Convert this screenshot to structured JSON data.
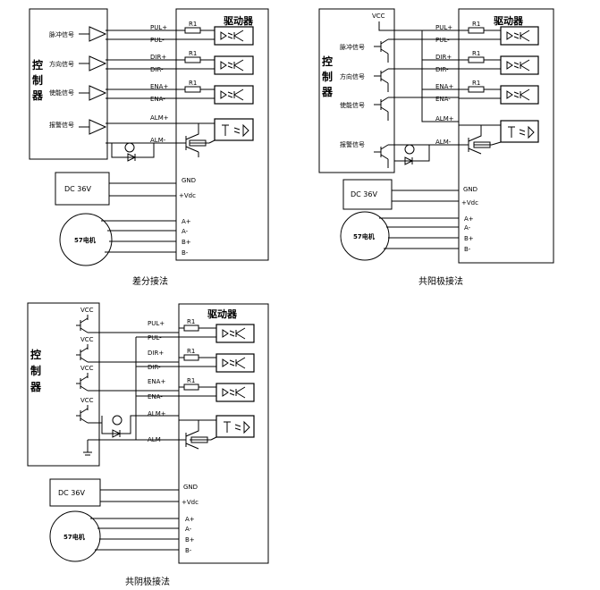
{
  "diagrams": [
    {
      "caption": "差分接法",
      "driver_title": "驱动器",
      "controller_label": [
        "控",
        "制",
        "器"
      ],
      "signals": [
        "脉冲信号",
        "方向信号",
        "使能信号",
        "报警信号"
      ],
      "pins": [
        "PUL+",
        "PUL-",
        "DIR+",
        "DIR-",
        "ENA+",
        "ENA-",
        "ALM+",
        "ALM-"
      ],
      "resistor": "R1",
      "power": {
        "label": "DC 36V",
        "gnd": "GND",
        "vdc": "+Vdc"
      },
      "motor": {
        "label": "57电机",
        "phases": [
          "A+",
          "A-",
          "B+",
          "B-"
        ]
      }
    },
    {
      "caption": "共阳极接法",
      "driver_title": "驱动器",
      "controller_label": [
        "控",
        "制",
        "器"
      ],
      "vcc": "VCC",
      "signals": [
        "脉冲信号",
        "方向信号",
        "使能信号",
        "报警信号"
      ],
      "pins": [
        "PUL+",
        "PUL-",
        "DIR+",
        "DIR-",
        "ENA+",
        "ENA-",
        "ALM+",
        "ALM-"
      ],
      "resistor": "R1",
      "power": {
        "label": "DC 36V",
        "gnd": "GND",
        "vdc": "+Vdc"
      },
      "motor": {
        "label": "57电机",
        "phases": [
          "A+",
          "A-",
          "B+",
          "B-"
        ]
      }
    },
    {
      "caption": "共阴极接法",
      "driver_title": "驱动器",
      "controller_label": [
        "控",
        "制",
        "器"
      ],
      "vcc": "VCC",
      "pins": [
        "PUL+",
        "PUL-",
        "DIR+",
        "DIR-",
        "ENA+",
        "ENA-",
        "ALM+",
        "ALM-"
      ],
      "resistor": "R1",
      "power": {
        "label": "DC 36V",
        "gnd": "GND",
        "vdc": "+Vdc"
      },
      "motor": {
        "label": "57电机",
        "phases": [
          "A+",
          "A-",
          "B+",
          "B-"
        ]
      }
    }
  ]
}
